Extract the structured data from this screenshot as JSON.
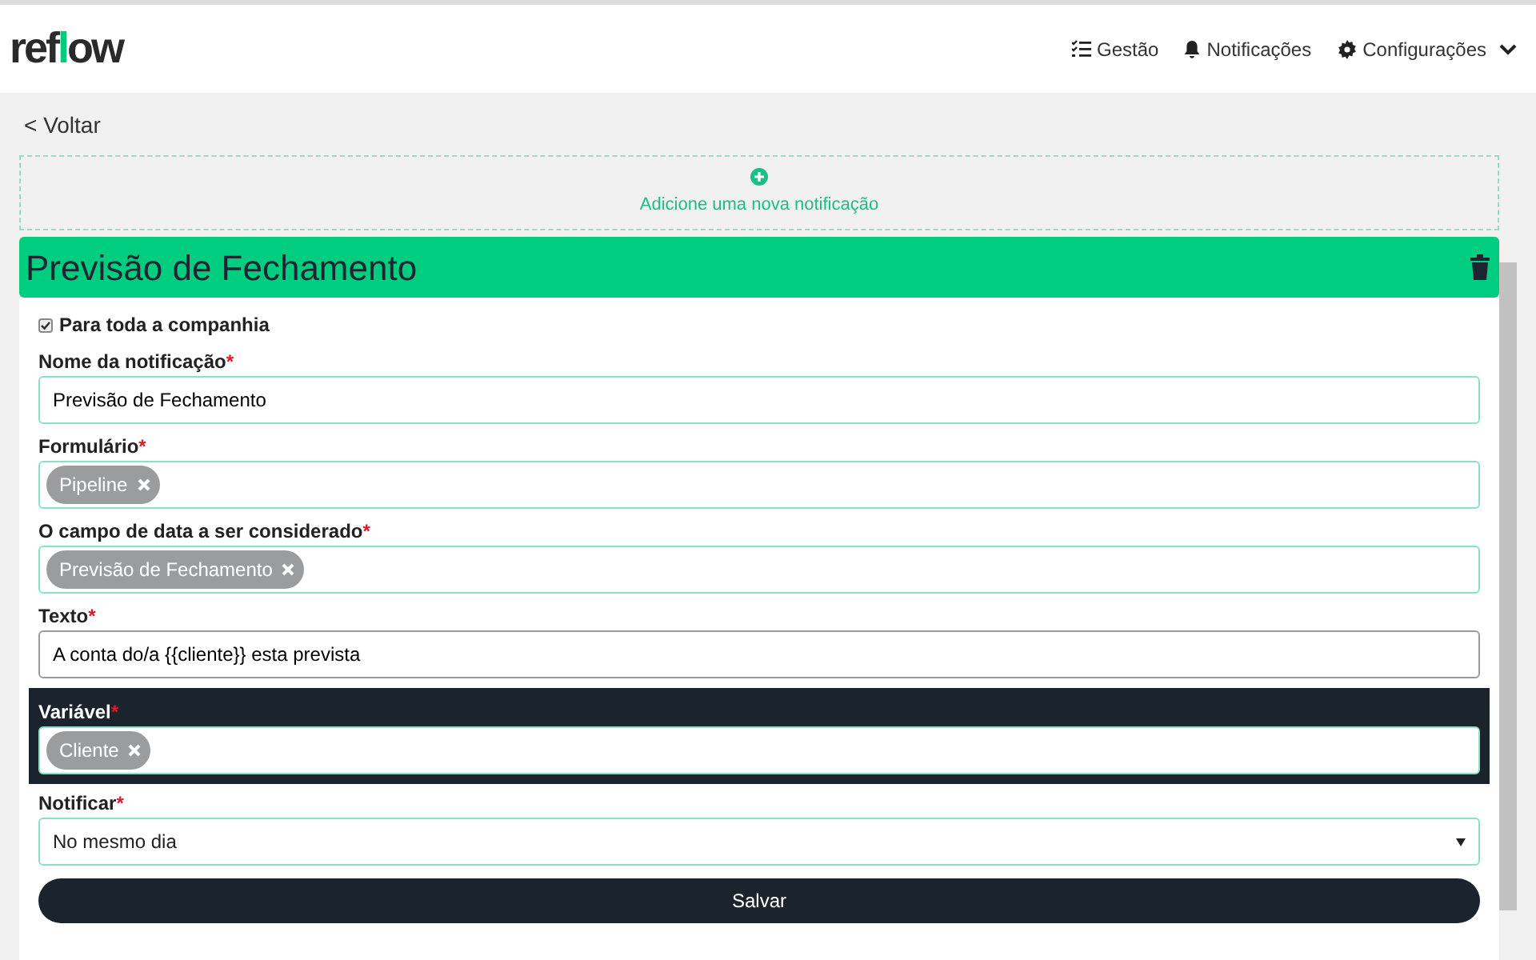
{
  "header": {
    "logo": "reflow",
    "nav": [
      {
        "kind": "list",
        "label": "Gestão"
      },
      {
        "kind": "bell",
        "label": "Notificações"
      },
      {
        "kind": "gear",
        "label": "Configurações",
        "dropdown": true
      }
    ]
  },
  "back_link": "< Voltar",
  "add_notification": {
    "label": "Adicione uma nova notificação"
  },
  "notification": {
    "title": "Previsão de Fechamento",
    "company_wide": {
      "label": "Para toda a companhia",
      "checked": true
    },
    "fields": [
      {
        "kind": "text",
        "label": "Nome da notificação",
        "required": "*",
        "value": "Previsão de Fechamento",
        "focused": false,
        "highlighted": false
      },
      {
        "kind": "tags",
        "label": "Formulário",
        "required": "*",
        "tags": [
          "Pipeline"
        ],
        "focused": false,
        "highlighted": false
      },
      {
        "kind": "tags",
        "label": "O campo de data a ser considerado",
        "required": "*",
        "tags": [
          "Previsão de Fechamento"
        ],
        "focused": false,
        "highlighted": false
      },
      {
        "kind": "text",
        "label": "Texto",
        "required": "*",
        "value": "A conta do/a {{cliente}} esta prevista",
        "focused": true,
        "highlighted": false
      },
      {
        "kind": "tags",
        "label": "Variável",
        "required": "*",
        "tags": [
          "Cliente"
        ],
        "focused": false,
        "highlighted": true
      },
      {
        "kind": "select",
        "label": "Notificar",
        "required": "*",
        "value": "No mesmo dia",
        "focused": false,
        "highlighted": false
      }
    ],
    "save_button": "Salvar"
  }
}
